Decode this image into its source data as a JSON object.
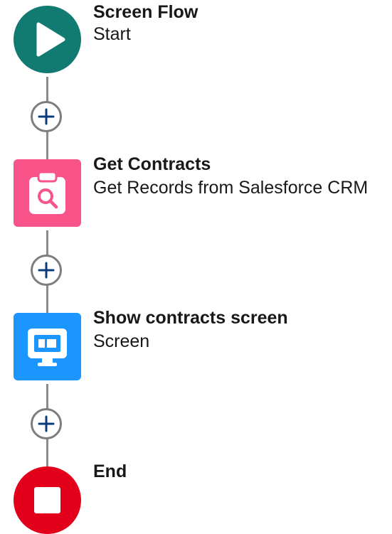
{
  "colors": {
    "start": "#117a71",
    "get_records": "#f9548a",
    "screen": "#1b96ff",
    "end": "#e3001b",
    "connector": "#8a8a8a",
    "add_icon": "#0b3b7a"
  },
  "nodes": [
    {
      "id": "start",
      "title": "Screen Flow",
      "subtitle": "Start",
      "icon": "play-icon"
    },
    {
      "id": "get_contracts",
      "title": "Get Contracts",
      "subtitle": "Get Records from Salesforce CRM",
      "icon": "clipboard-search-icon"
    },
    {
      "id": "show_contracts",
      "title": "Show contracts screen",
      "subtitle": "Screen",
      "icon": "monitor-icon"
    },
    {
      "id": "end",
      "title": "End",
      "icon": "stop-icon"
    }
  ],
  "add_buttons": [
    {
      "icon": "plus-icon"
    },
    {
      "icon": "plus-icon"
    },
    {
      "icon": "plus-icon"
    }
  ]
}
